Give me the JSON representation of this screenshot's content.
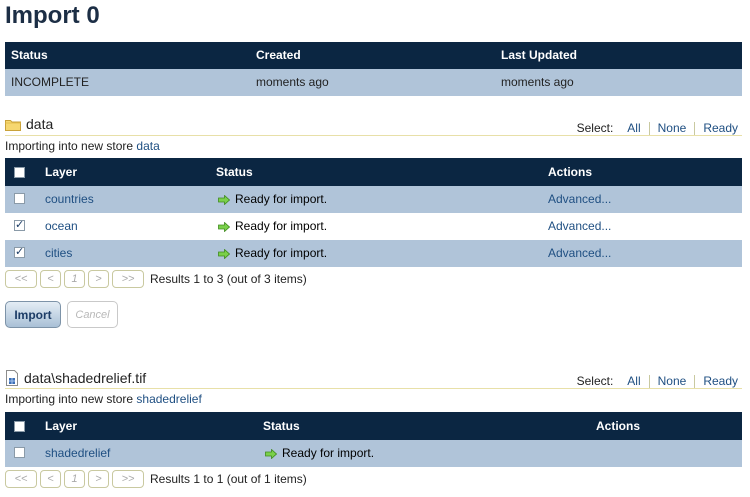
{
  "page": {
    "title": "Import 0"
  },
  "summary": {
    "headers": [
      "Status",
      "Created",
      "Last Updated"
    ],
    "row": [
      "INCOMPLETE",
      "moments ago",
      "moments ago"
    ]
  },
  "select": {
    "label": "Select:",
    "all": "All",
    "none": "None",
    "ready": "Ready"
  },
  "sections": [
    {
      "name": "data",
      "icon": "folder-icon",
      "store_prefix": "Importing into new store",
      "store_name": "data",
      "headers": {
        "layer": "Layer",
        "status": "Status",
        "actions": "Actions"
      },
      "rows": [
        {
          "layer": "countries",
          "status": "Ready for import.",
          "action": "Advanced...",
          "checked": false
        },
        {
          "layer": "ocean",
          "status": "Ready for import.",
          "action": "Advanced...",
          "checked": true
        },
        {
          "layer": "cities",
          "status": "Ready for import.",
          "action": "Advanced...",
          "checked": true
        }
      ],
      "pager": {
        "first": "<<",
        "prev": "<",
        "page": "1",
        "next": ">",
        "last": ">>",
        "results": "Results 1 to 3 (out of 3 items)"
      }
    },
    {
      "name": "data\\shadedrelief.tif",
      "icon": "raster-file-icon",
      "store_prefix": "Importing into new store",
      "store_name": "shadedrelief",
      "headers": {
        "layer": "Layer",
        "status": "Status",
        "actions": "Actions"
      },
      "rows": [
        {
          "layer": "shadedrelief",
          "status": "Ready for import.",
          "action": "",
          "checked": false
        }
      ],
      "pager": {
        "first": "<<",
        "prev": "<",
        "page": "1",
        "next": ">",
        "last": ">>",
        "results": "Results 1 to 1 (out of 1 items)"
      }
    }
  ],
  "buttons": {
    "import": "Import",
    "cancel": "Cancel"
  },
  "colors": {
    "header_bg": "#0b2642",
    "row_shade": "#b0c4d9",
    "link": "#1f4f82",
    "ready_arrow": "#5cb82a"
  }
}
